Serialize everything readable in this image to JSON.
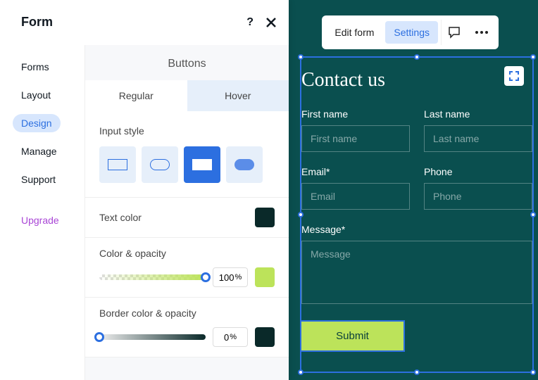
{
  "panel": {
    "title": "Form",
    "sidebar": {
      "items": [
        {
          "label": "Forms",
          "active": false
        },
        {
          "label": "Layout",
          "active": false
        },
        {
          "label": "Design",
          "active": true
        },
        {
          "label": "Manage",
          "active": false
        },
        {
          "label": "Support",
          "active": false
        }
      ],
      "upgrade": "Upgrade"
    },
    "section": "Buttons",
    "tabs": [
      {
        "label": "Regular",
        "active": true
      },
      {
        "label": "Hover",
        "active": false
      }
    ],
    "inputStyle": {
      "label": "Input style"
    },
    "textColor": {
      "label": "Text color",
      "value": "#0a2929"
    },
    "colorOpacity": {
      "label": "Color & opacity",
      "pct": "100",
      "unit": "%",
      "swatch": "#bce35a"
    },
    "borderColorOpacity": {
      "label": "Border color & opacity",
      "pct": "0",
      "unit": "%",
      "swatch": "#0a2929"
    }
  },
  "topbar": {
    "edit": "Edit form",
    "settings": "Settings"
  },
  "form": {
    "title": "Contact us",
    "fields": {
      "firstName": {
        "label": "First name",
        "placeholder": "First name"
      },
      "lastName": {
        "label": "Last name",
        "placeholder": "Last name"
      },
      "email": {
        "label": "Email*",
        "placeholder": "Email"
      },
      "phone": {
        "label": "Phone",
        "placeholder": "Phone"
      },
      "message": {
        "label": "Message*",
        "placeholder": "Message"
      }
    },
    "submit": "Submit"
  }
}
